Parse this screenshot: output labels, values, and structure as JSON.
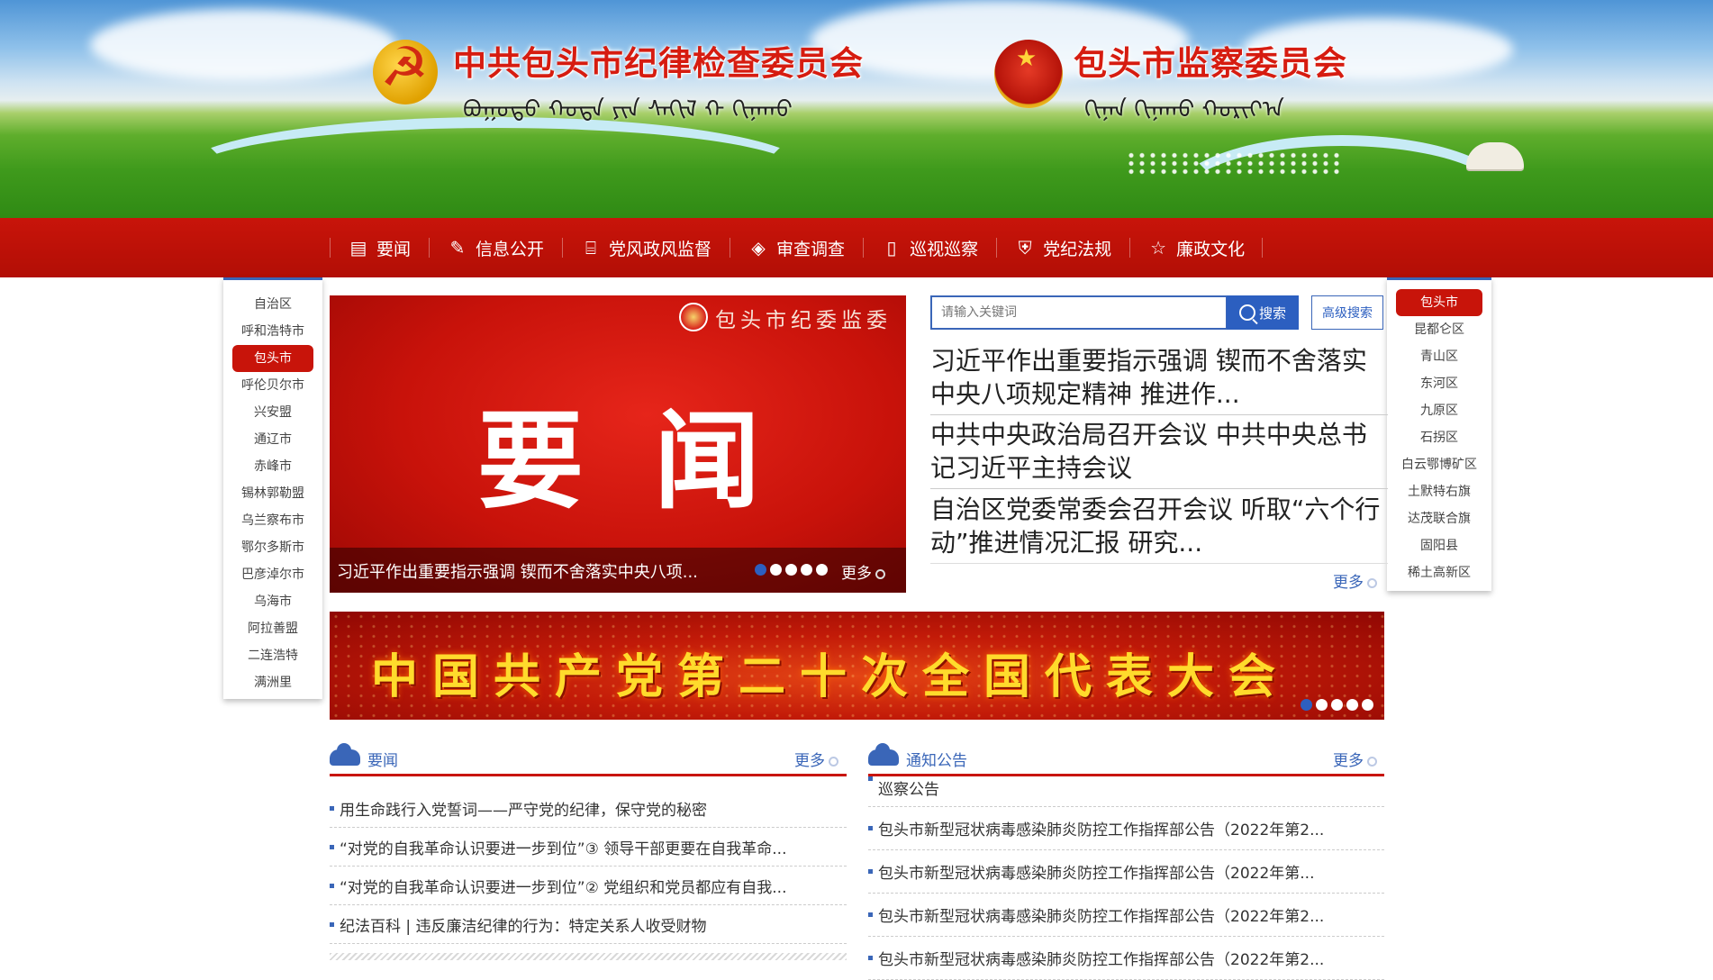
{
  "header": {
    "left_title": "中共包头市纪律检查委员会",
    "left_mongolian": "ᠪᠤᠭᠤᠲᠤ ᠬᠣᠲᠠ ᠶᠢᠨ ᠰᠠᠬᠢᠯ ᠭ᠋ ᠬᠢᠨᠠᠬᠤ",
    "right_title": "包头市监察委员会",
    "right_mongolian": "ᠬᠢᠨᠠᠨ ᠬᠢᠨᠠᠬᠤ ᠬᠣᠷᠢᠶ᠎ᠠ"
  },
  "nav": {
    "items": [
      {
        "label": "要闻",
        "icon": "clipboard-icon"
      },
      {
        "label": "信息公开",
        "icon": "edit-icon"
      },
      {
        "label": "党风政风监督",
        "icon": "book-icon"
      },
      {
        "label": "审查调查",
        "icon": "layers-icon"
      },
      {
        "label": "巡视巡察",
        "icon": "open-book-icon"
      },
      {
        "label": "党纪法规",
        "icon": "shield-plus-icon"
      },
      {
        "label": "廉政文化",
        "icon": "star-icon"
      }
    ]
  },
  "left_regions": {
    "items": [
      "自治区",
      "呼和浩特市",
      "包头市",
      "呼伦贝尔市",
      "兴安盟",
      "通辽市",
      "赤峰市",
      "锡林郭勒盟",
      "乌兰察布市",
      "鄂尔多斯市",
      "巴彦淖尔市",
      "乌海市",
      "阿拉善盟",
      "二连浩特",
      "满洲里"
    ],
    "active": "包头市"
  },
  "right_regions": {
    "items": [
      "包头市",
      "昆都仑区",
      "青山区",
      "东河区",
      "九原区",
      "石拐区",
      "白云鄂博矿区",
      "土默特右旗",
      "达茂联合旗",
      "固阳县",
      "稀土高新区"
    ],
    "active": "包头市"
  },
  "hero": {
    "org": "包头市纪委监委",
    "big_text": "要闻",
    "caption": "习近平作出重要指示强调 锲而不舍落实中央八项...",
    "more": "更多",
    "slide_count": 5,
    "active_slide": 1
  },
  "search": {
    "placeholder": "请输入关键词",
    "button": "搜索",
    "advanced": "高级搜索"
  },
  "headlines": [
    "习近平作出重要指示强调 锲而不舍落实中央八项规定精神 推进作...",
    "中共中央政治局召开会议 中共中央总书记习近平主持会议",
    "自治区党委常委会召开会议 听取“六个行动”推进情况汇报 研究..."
  ],
  "headlines_more": "更多",
  "congress": {
    "text": "中国共产党第二十次全国代表大会",
    "slide_count": 5,
    "active_slide": 1
  },
  "news_list": {
    "title": "要闻",
    "more": "更多",
    "items": [
      "用生命践行入党誓词——严守党的纪律，保守党的秘密",
      "“对党的自我革命认识要进一步到位”③ 领导干部更要在自我革命...",
      "“对党的自我革命认识要进一步到位”② 党组织和党员都应有自我...",
      "纪法百科 | 违反廉洁纪律的行为：特定关系人收受财物"
    ]
  },
  "notice_list": {
    "title": "通知公告",
    "more": "更多",
    "items": [
      "巡察公告",
      "包头市新型冠状病毒感染肺炎防控工作指挥部公告（2022年第2...",
      "包头市新型冠状病毒感染肺炎防控工作指挥部公告（2022年第...",
      "包头市新型冠状病毒感染肺炎防控工作指挥部公告（2022年第2...",
      "包头市新型冠状病毒感染肺炎防控工作指挥部公告（2022年第2..."
    ]
  },
  "colors": {
    "nav_red": "#c8140a",
    "link_blue": "#3a66b8",
    "title_red": "#d61c10",
    "congress_gold": "#ffdb2c"
  }
}
